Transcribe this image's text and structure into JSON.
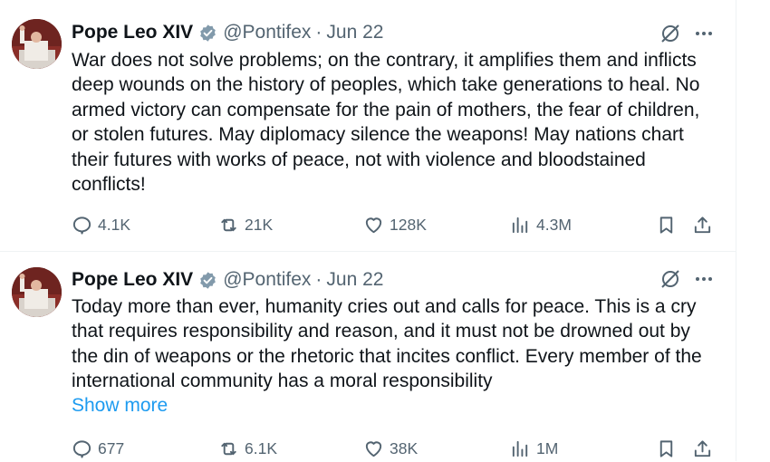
{
  "tweets": [
    {
      "name": "Pope Leo XIV",
      "handle": "@Pontifex",
      "separator": "·",
      "date": "Jun 22",
      "text": "War does not solve problems; on the contrary, it amplifies them and inflicts\ndeep wounds on the history of peoples, which take generations to heal. No\narmed victory can compensate for the pain of mothers, the fear of children,\nor stolen futures. May diplomacy silence the weapons! May nations chart\ntheir futures with works of peace, not with violence and bloodstained\nconflicts!",
      "replies": "4.1K",
      "reposts": "21K",
      "likes": "128K",
      "views": "4.3M"
    },
    {
      "name": "Pope Leo XIV",
      "handle": "@Pontifex",
      "separator": "·",
      "date": "Jun 22",
      "text": "Today more than ever, humanity cries out and calls for peace. This is a cry\nthat requires responsibility and reason, and it must not be drowned out by\nthe din of weapons or the rhetoric that incites conflict. Every member of the\ninternational community has a moral responsibility",
      "show_more": "Show more",
      "replies": "677",
      "reposts": "6.1K",
      "likes": "38K",
      "views": "1M"
    }
  ],
  "icons": {
    "verified": "verified-badge-icon",
    "grok": "grok-icon",
    "more": "more-icon",
    "reply": "reply-icon",
    "repost": "repost-icon",
    "like": "like-icon",
    "views": "views-icon",
    "bookmark": "bookmark-icon",
    "share": "share-icon"
  },
  "colors": {
    "accent": "#1d9bf0",
    "muted": "#536471",
    "text": "#0f1419",
    "verified": "#829aab"
  }
}
